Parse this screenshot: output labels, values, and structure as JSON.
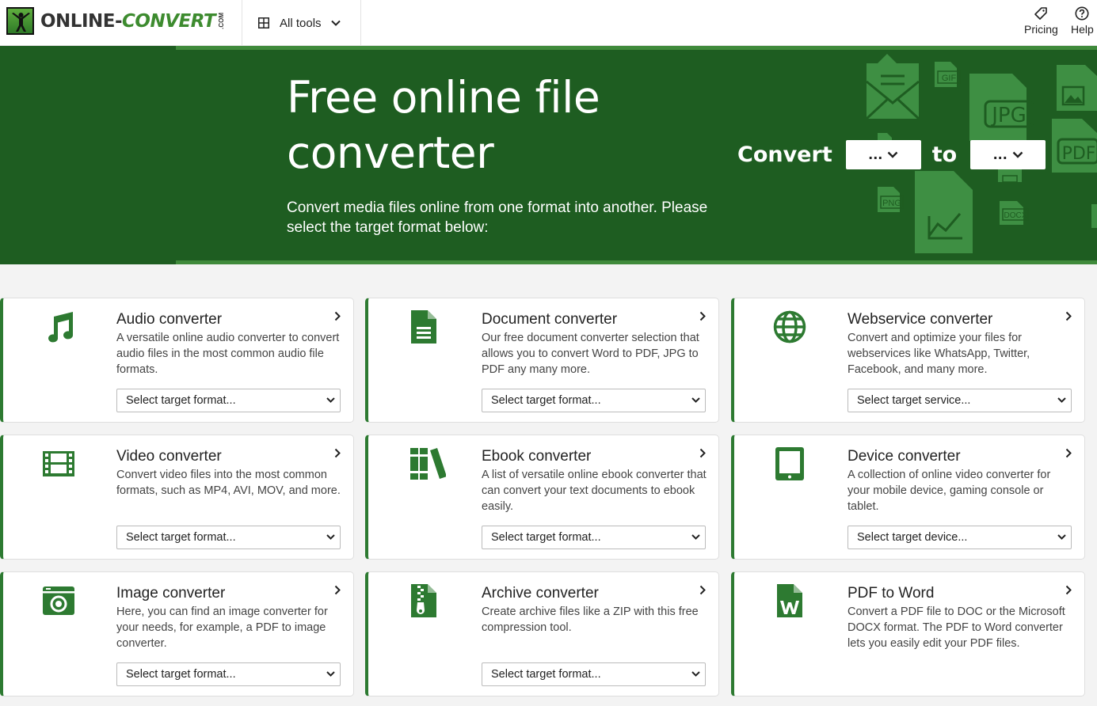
{
  "header": {
    "logo_text_a": "ONLINE-",
    "logo_text_b": "CONVERT",
    "logo_com": ".COM",
    "all_tools_label": "All tools",
    "pricing_label": "Pricing",
    "help_label": "Help"
  },
  "hero": {
    "title": "Free online file converter",
    "subtitle": "Convert media files online from one format into another. Please select the target format below:",
    "convert_label": "Convert",
    "from_value": "...",
    "to_label": "to",
    "to_value": "...",
    "deco_labels": [
      "GIF",
      "JPG",
      "PDF",
      "PNG",
      "DOCX"
    ]
  },
  "cards": [
    {
      "title": "Audio converter",
      "desc": "A versatile online audio converter to convert audio files in the most common audio file formats.",
      "select": "Select target format...",
      "icon": "music-note-icon"
    },
    {
      "title": "Document converter",
      "desc": "Our free document converter selection that allows you to convert Word to PDF, JPG to PDF any many more.",
      "select": "Select target format...",
      "icon": "document-icon"
    },
    {
      "title": "Webservice converter",
      "desc": "Convert and optimize your files for webservices like WhatsApp, Twitter, Facebook, and many more.",
      "select": "Select target service...",
      "icon": "globe-icon"
    },
    {
      "title": "Video converter",
      "desc": "Convert video files into the most common formats, such as MP4, AVI, MOV, and more.",
      "select": "Select target format...",
      "icon": "film-icon"
    },
    {
      "title": "Ebook converter",
      "desc": "A list of versatile online ebook converter that can convert your text documents to ebook easily.",
      "select": "Select target format...",
      "icon": "books-icon"
    },
    {
      "title": "Device converter",
      "desc": "A collection of online video converter for your mobile device, gaming console or tablet.",
      "select": "Select target device...",
      "icon": "tablet-icon"
    },
    {
      "title": "Image converter",
      "desc": "Here, you can find an image converter for your needs, for example, a PDF to image converter.",
      "select": "Select target format...",
      "icon": "camera-icon"
    },
    {
      "title": "Archive converter",
      "desc": "Create archive files like a ZIP with this free compression tool.",
      "select": "Select target format...",
      "icon": "zip-file-icon"
    },
    {
      "title": "PDF to Word",
      "desc": "Convert a PDF file to DOC or the Microsoft DOCX format. The PDF to Word converter lets you easily edit your PDF files.",
      "select": "",
      "icon": "word-file-icon"
    }
  ],
  "colors": {
    "brand_green": "#1e5d21",
    "accent_green": "#2d7a31",
    "light_green": "#3f8a3b"
  }
}
